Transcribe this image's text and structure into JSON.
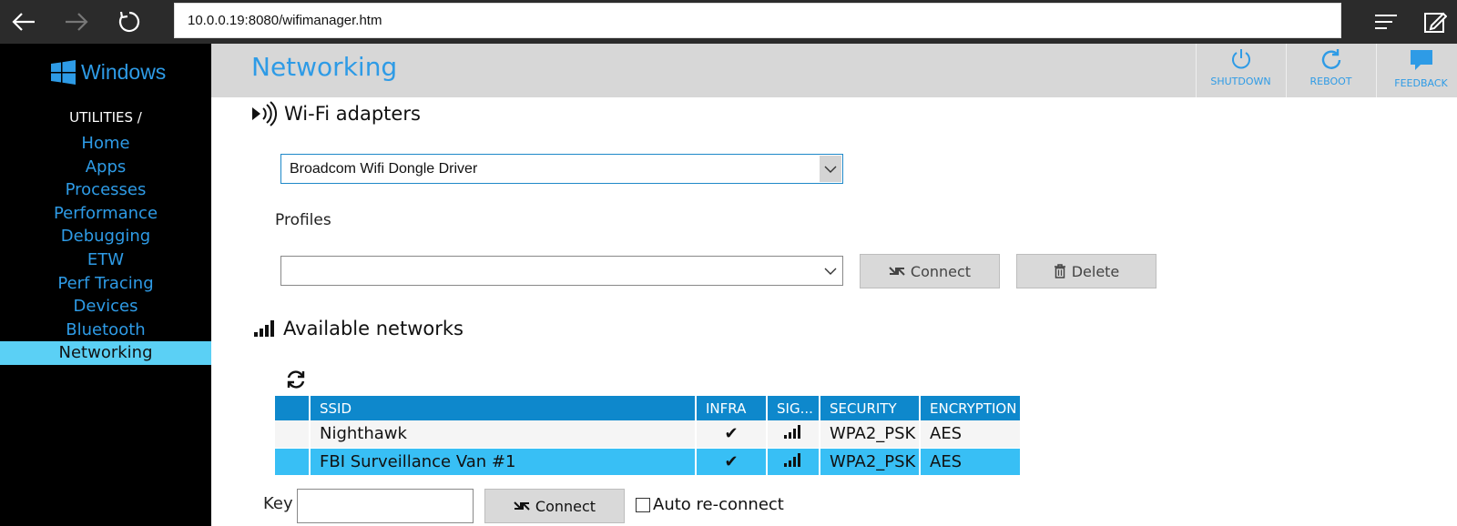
{
  "browser": {
    "url": "10.0.0.19:8080/wifimanager.htm"
  },
  "sidebar": {
    "logo_text": "Windows",
    "section_title": "UTILITIES /",
    "items": [
      {
        "label": "Home"
      },
      {
        "label": "Apps"
      },
      {
        "label": "Processes"
      },
      {
        "label": "Performance"
      },
      {
        "label": "Debugging"
      },
      {
        "label": "ETW"
      },
      {
        "label": "Perf Tracing"
      },
      {
        "label": "Devices"
      },
      {
        "label": "Bluetooth"
      },
      {
        "label": "Networking",
        "active": true
      }
    ]
  },
  "header": {
    "title": "Networking",
    "buttons": [
      {
        "label": "SHUTDOWN",
        "icon": "power-icon"
      },
      {
        "label": "REBOOT",
        "icon": "refresh-icon"
      },
      {
        "label": "FEEDBACK",
        "icon": "feedback-icon"
      }
    ]
  },
  "wifi": {
    "section_title": "Wi-Fi adapters",
    "adapter_selected": "Broadcom Wifi Dongle Driver",
    "profiles_label": "Profiles",
    "profile_selected": "",
    "connect_label": "Connect",
    "delete_label": "Delete"
  },
  "networks": {
    "section_title": "Available networks",
    "columns": [
      "",
      "SSID",
      "INFRA",
      "SIG...",
      "SECURITY",
      "ENCRYPTION"
    ],
    "rows": [
      {
        "ssid": "Nighthawk",
        "infra": "✔",
        "security": "WPA2_PSK",
        "encryption": "AES",
        "selected": false
      },
      {
        "ssid": "FBI Surveillance Van #1",
        "infra": "✔",
        "security": "WPA2_PSK",
        "encryption": "AES",
        "selected": true
      }
    ],
    "key_label": "Key",
    "key_value": "",
    "connect_label": "Connect",
    "auto_reconnect_label": "Auto re-connect",
    "auto_reconnect_checked": false
  },
  "colors": {
    "accent": "#2e9be6",
    "header_bg": "#d7d7d7",
    "table_header": "#0e88cc",
    "selected_row": "#38bff5",
    "active_nav": "#5bd0f5"
  }
}
